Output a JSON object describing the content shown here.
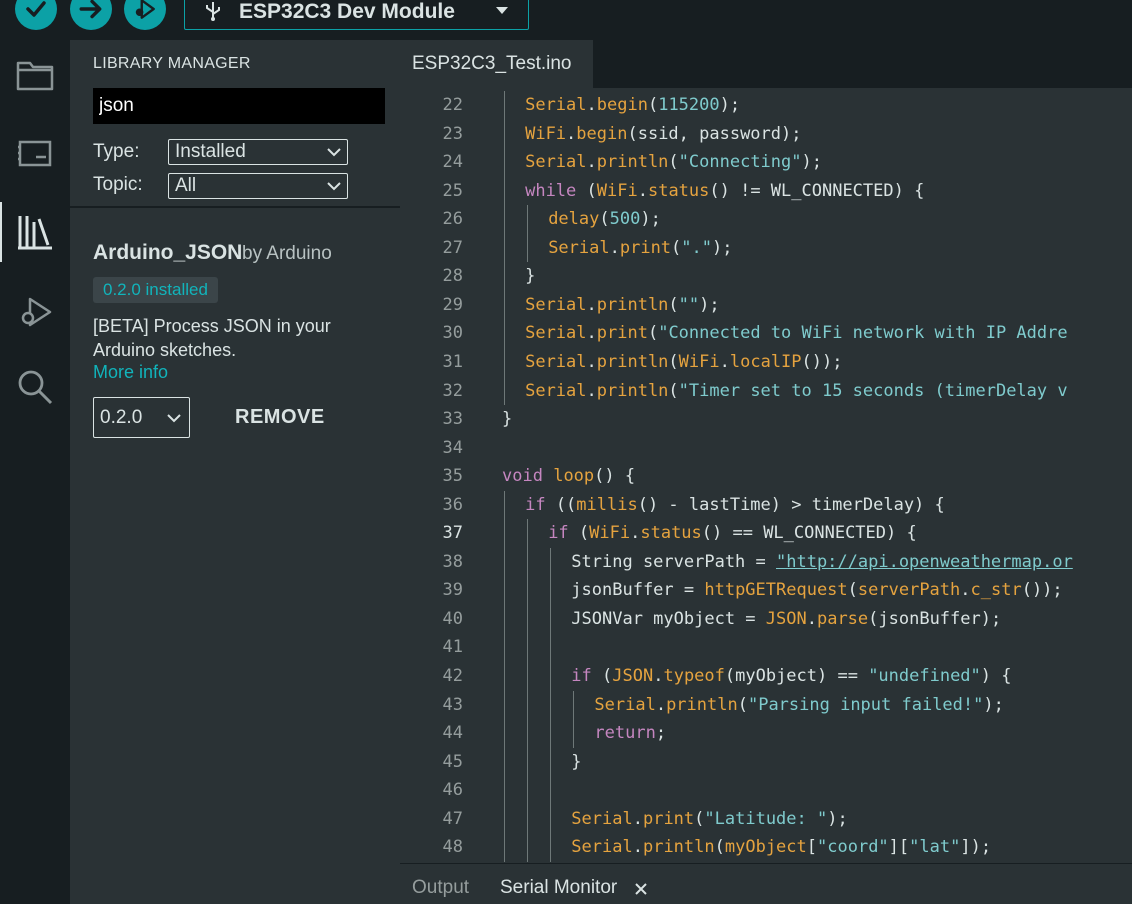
{
  "toolbar": {
    "verify_icon": "check-icon",
    "upload_icon": "arrow-right-icon",
    "debug_icon": "debug-icon",
    "board": "ESP32C3 Dev Module"
  },
  "activity": [
    "folder-icon",
    "board-icon",
    "library-icon",
    "debug-icon",
    "search-icon"
  ],
  "library_manager": {
    "title": "LIBRARY MANAGER",
    "search_value": "json",
    "type_label": "Type:",
    "type_value": "Installed",
    "topic_label": "Topic:",
    "topic_value": "All",
    "item": {
      "name": "Arduino_JSON",
      "by": "by Arduino",
      "badge": "0.2.0 installed",
      "description": "[BETA] Process JSON in your Arduino sketches.",
      "more_info": "More info",
      "version": "0.2.0",
      "remove": "REMOVE"
    }
  },
  "editor": {
    "tab": "ESP32C3_Test.ino",
    "current_line": "37",
    "line_numbers": [
      "22",
      "23",
      "24",
      "25",
      "26",
      "27",
      "28",
      "29",
      "30",
      "31",
      "32",
      "33",
      "34",
      "35",
      "36",
      "37",
      "38",
      "39",
      "40",
      "41",
      "42",
      "43",
      "44",
      "45",
      "46",
      "47",
      "48"
    ],
    "lines": [
      [
        [
          "fn",
          "Serial"
        ],
        [
          "",
          "."
        ],
        [
          "fn",
          "begin"
        ],
        [
          "",
          "("
        ],
        [
          "num",
          "115200"
        ],
        [
          "",
          ");"
        ]
      ],
      [
        [
          "fn",
          "WiFi"
        ],
        [
          "",
          "."
        ],
        [
          "fn",
          "begin"
        ],
        [
          "",
          "(ssid, password);"
        ]
      ],
      [
        [
          "fn",
          "Serial"
        ],
        [
          "",
          "."
        ],
        [
          "fn",
          "println"
        ],
        [
          "",
          "("
        ],
        [
          "str",
          "\"Connecting\""
        ],
        [
          "",
          ");"
        ]
      ],
      [
        [
          "kw",
          "while"
        ],
        [
          "",
          " ("
        ],
        [
          "fn",
          "WiFi"
        ],
        [
          "",
          "."
        ],
        [
          "fn",
          "status"
        ],
        [
          "",
          "() != WL_CONNECTED) {"
        ]
      ],
      [
        [
          "fn",
          "delay"
        ],
        [
          "",
          "("
        ],
        [
          "num",
          "500"
        ],
        [
          "",
          ");"
        ]
      ],
      [
        [
          "fn",
          "Serial"
        ],
        [
          "",
          "."
        ],
        [
          "fn",
          "print"
        ],
        [
          "",
          "("
        ],
        [
          "str",
          "\".\""
        ],
        [
          "",
          ");"
        ]
      ],
      [
        [
          "",
          "}"
        ]
      ],
      [
        [
          "fn",
          "Serial"
        ],
        [
          "",
          "."
        ],
        [
          "fn",
          "println"
        ],
        [
          "",
          "("
        ],
        [
          "str",
          "\"\""
        ],
        [
          "",
          ");"
        ]
      ],
      [
        [
          "fn",
          "Serial"
        ],
        [
          "",
          "."
        ],
        [
          "fn",
          "print"
        ],
        [
          "",
          "("
        ],
        [
          "str",
          "\"Connected to WiFi network with IP Addre"
        ]
      ],
      [
        [
          "fn",
          "Serial"
        ],
        [
          "",
          "."
        ],
        [
          "fn",
          "println"
        ],
        [
          "",
          "("
        ],
        [
          "fn",
          "WiFi"
        ],
        [
          "",
          "."
        ],
        [
          "fn",
          "localIP"
        ],
        [
          "",
          "());"
        ]
      ],
      [
        [
          "fn",
          "Serial"
        ],
        [
          "",
          "."
        ],
        [
          "fn",
          "println"
        ],
        [
          "",
          "("
        ],
        [
          "str",
          "\"Timer set to 15 seconds (timerDelay v"
        ]
      ],
      [
        [
          "",
          "}"
        ]
      ],
      [],
      [
        [
          "kw",
          "void"
        ],
        [
          "",
          " "
        ],
        [
          "fn",
          "loop"
        ],
        [
          "",
          "() {"
        ]
      ],
      [
        [
          "kw",
          "if"
        ],
        [
          "",
          " (("
        ],
        [
          "fn",
          "millis"
        ],
        [
          "",
          "() - lastTime) > timerDelay) {"
        ]
      ],
      [
        [
          "kw",
          "if"
        ],
        [
          "",
          " ("
        ],
        [
          "fn",
          "WiFi"
        ],
        [
          "",
          "."
        ],
        [
          "fn",
          "status"
        ],
        [
          "",
          "() == WL_CONNECTED) {"
        ]
      ],
      [
        [
          "",
          "String serverPath = "
        ],
        [
          "url",
          "\"http://api.openweathermap.or"
        ]
      ],
      [
        [
          "",
          "jsonBuffer = "
        ],
        [
          "fn",
          "httpGETRequest"
        ],
        [
          "",
          "("
        ],
        [
          "fn",
          "serverPath"
        ],
        [
          "",
          "."
        ],
        [
          "fn",
          "c_str"
        ],
        [
          "",
          "());"
        ]
      ],
      [
        [
          "",
          "JSONVar myObject = "
        ],
        [
          "fn",
          "JSON"
        ],
        [
          "",
          "."
        ],
        [
          "fn",
          "parse"
        ],
        [
          "",
          "(jsonBuffer);"
        ]
      ],
      [],
      [
        [
          "kw",
          "if"
        ],
        [
          "",
          " ("
        ],
        [
          "fn",
          "JSON"
        ],
        [
          "",
          "."
        ],
        [
          "fn",
          "typeof"
        ],
        [
          "",
          "(myObject) == "
        ],
        [
          "str",
          "\"undefined\""
        ],
        [
          "",
          ") {"
        ]
      ],
      [
        [
          "fn",
          "Serial"
        ],
        [
          "",
          "."
        ],
        [
          "fn",
          "println"
        ],
        [
          "",
          "("
        ],
        [
          "str",
          "\"Parsing input failed!\""
        ],
        [
          "",
          ");"
        ]
      ],
      [
        [
          "kw",
          "return"
        ],
        [
          "",
          ";"
        ]
      ],
      [
        [
          "",
          "}"
        ]
      ],
      [],
      [
        [
          "fn",
          "Serial"
        ],
        [
          "",
          "."
        ],
        [
          "fn",
          "print"
        ],
        [
          "",
          "("
        ],
        [
          "str",
          "\"Latitude: \""
        ],
        [
          "",
          ");"
        ]
      ],
      [
        [
          "fn",
          "Serial"
        ],
        [
          "",
          "."
        ],
        [
          "fn",
          "println"
        ],
        [
          "",
          "("
        ],
        [
          "fn",
          "myObject"
        ],
        [
          "",
          "["
        ],
        [
          "str",
          "\"coord\""
        ],
        [
          "",
          "]["
        ],
        [
          "str",
          "\"lat\""
        ],
        [
          "",
          "]);"
        ]
      ]
    ]
  },
  "bottom_panel": {
    "output_tab": "Output",
    "serial_tab": "Serial Monitor",
    "close_icon": "close-icon"
  }
}
